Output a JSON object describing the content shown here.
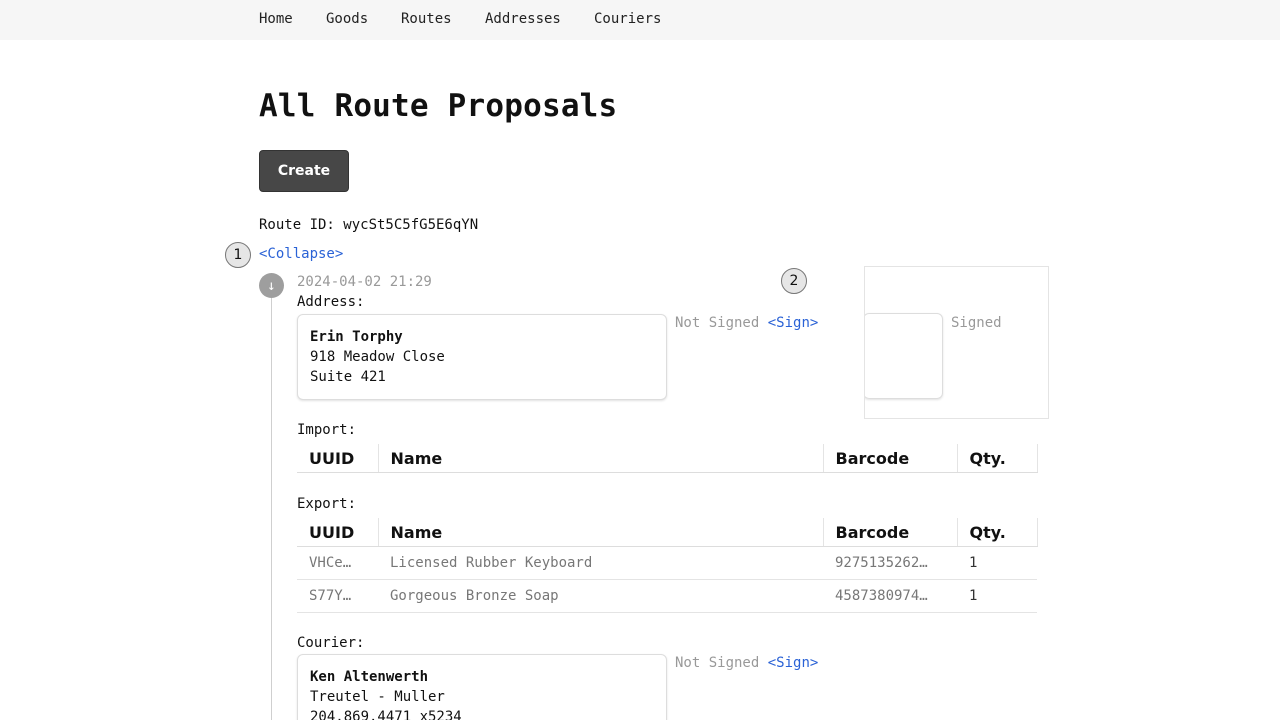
{
  "nav": {
    "items": [
      "Home",
      "Goods",
      "Routes",
      "Addresses",
      "Couriers"
    ]
  },
  "page": {
    "title": "All Route Proposals",
    "create_label": "Create"
  },
  "route": {
    "id_text": "Route ID: wycSt5C5fG5E6qYN",
    "collapse_label": "<Collapse>",
    "markers": [
      "1",
      "2"
    ],
    "timeline_icon": "↓",
    "entry": {
      "timestamp": "2024-04-02 21:29",
      "address_label": "Address:",
      "address": {
        "name": "Erin Torphy",
        "line1": "918 Meadow Close",
        "line2": "Suite 421"
      },
      "address_status": "Not Signed",
      "address_sign_link": "<Sign>",
      "signature_status": "Signed",
      "import_label": "Import:",
      "export_label": "Export:",
      "columns": [
        "UUID",
        "Name",
        "Barcode",
        "Qty."
      ],
      "import_rows": [],
      "export_rows": [
        {
          "uuid": "VHCe…",
          "name": "Licensed Rubber Keyboard",
          "barcode": "9275135262…",
          "qty": "1"
        },
        {
          "uuid": "S77Y…",
          "name": "Gorgeous Bronze Soap",
          "barcode": "4587380974…",
          "qty": "1"
        }
      ],
      "courier_label": "Courier:",
      "courier": {
        "name": "Ken Altenwerth",
        "company": "Treutel - Muller",
        "phone": "204.869.4471 x5234"
      },
      "courier_status": "Not Signed",
      "courier_sign_link": "<Sign>"
    }
  }
}
